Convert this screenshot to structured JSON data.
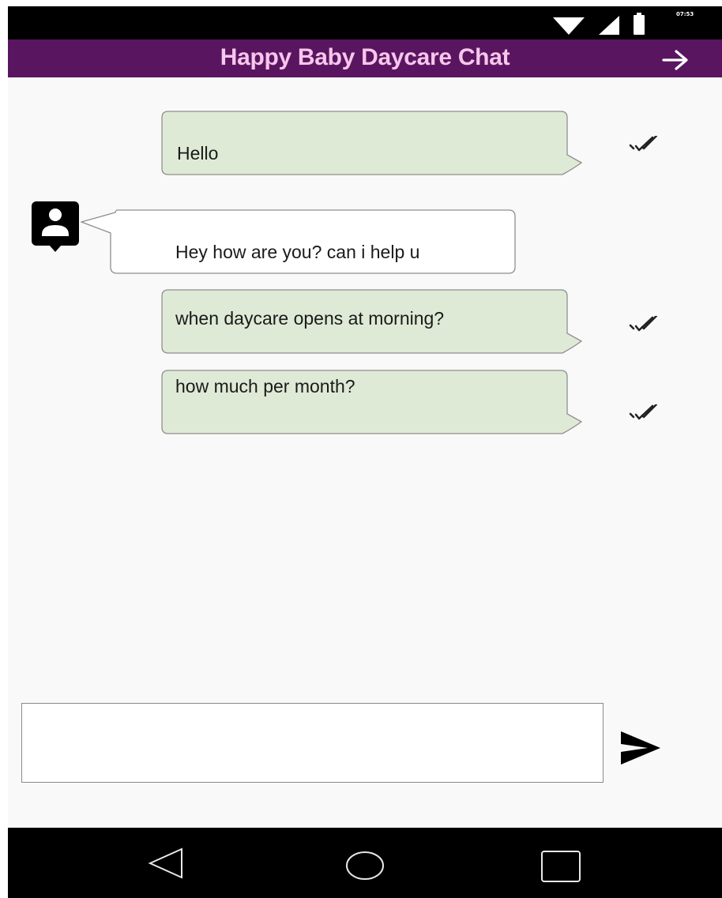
{
  "status_bar": {
    "time": "07:53",
    "icons": [
      "wifi-icon",
      "signal-icon",
      "battery-icon"
    ]
  },
  "app_bar": {
    "title": "Happy Baby Daycare Chat",
    "action_icon": "arrow-right-icon"
  },
  "messages": [
    {
      "sender": "me",
      "text": "Hello",
      "status_icon": "double-check-icon"
    },
    {
      "sender": "other",
      "text": "Hey how are you? can i help u",
      "avatar_icon": "contact-avatar-icon"
    },
    {
      "sender": "me",
      "text": "when daycare opens at morning?",
      "status_icon": "double-check-icon"
    },
    {
      "sender": "me",
      "text": "how much per month?",
      "status_icon": "double-check-icon"
    }
  ],
  "composer": {
    "value": "",
    "placeholder": "",
    "send_icon": "send-icon"
  },
  "nav_bar": {
    "buttons": [
      "back-icon",
      "home-icon",
      "recents-icon"
    ]
  },
  "colors": {
    "app_bar": "#5a1560",
    "title": "#f7c6ec",
    "sent_bubble": "#dfead6",
    "received_bubble": "#ffffff",
    "background": "#f9f9f9"
  }
}
